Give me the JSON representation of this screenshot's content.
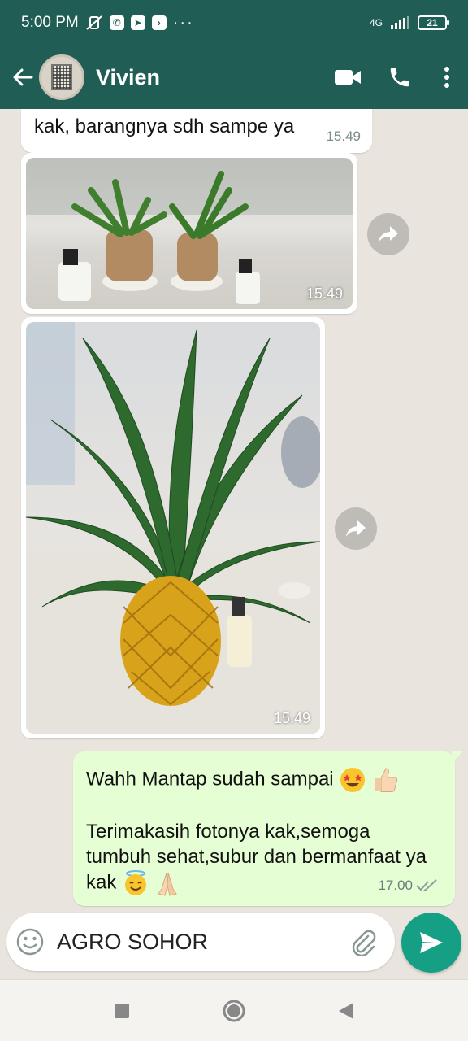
{
  "status_bar": {
    "time": "5:00 PM",
    "network": "4G",
    "battery": "21"
  },
  "header": {
    "contact_name": "Vivien"
  },
  "messages": [
    {
      "type": "text",
      "direction": "in",
      "text": "kak, barangnya sdh sampe ya",
      "time": "15.49"
    },
    {
      "type": "image",
      "direction": "in",
      "time": "15.49",
      "image_icon": "plant-photo"
    },
    {
      "type": "image",
      "direction": "in",
      "time": "15.49",
      "image_icon": "pineapple-pot-photo"
    },
    {
      "type": "text",
      "direction": "out",
      "line1": "Wahh Mantap sudah sampai",
      "line2": "Terimakasih fotonya kak,semoga tumbuh sehat,subur dan bermanfaat ya kak",
      "time": "17.00",
      "status": "read"
    }
  ],
  "composer": {
    "value": "AGRO SOHOR"
  },
  "colors": {
    "header": "#1f5d55",
    "outgoing_bubble": "#e6fed3",
    "send_button": "#15a085",
    "chat_bg": "#e9e4dd"
  }
}
